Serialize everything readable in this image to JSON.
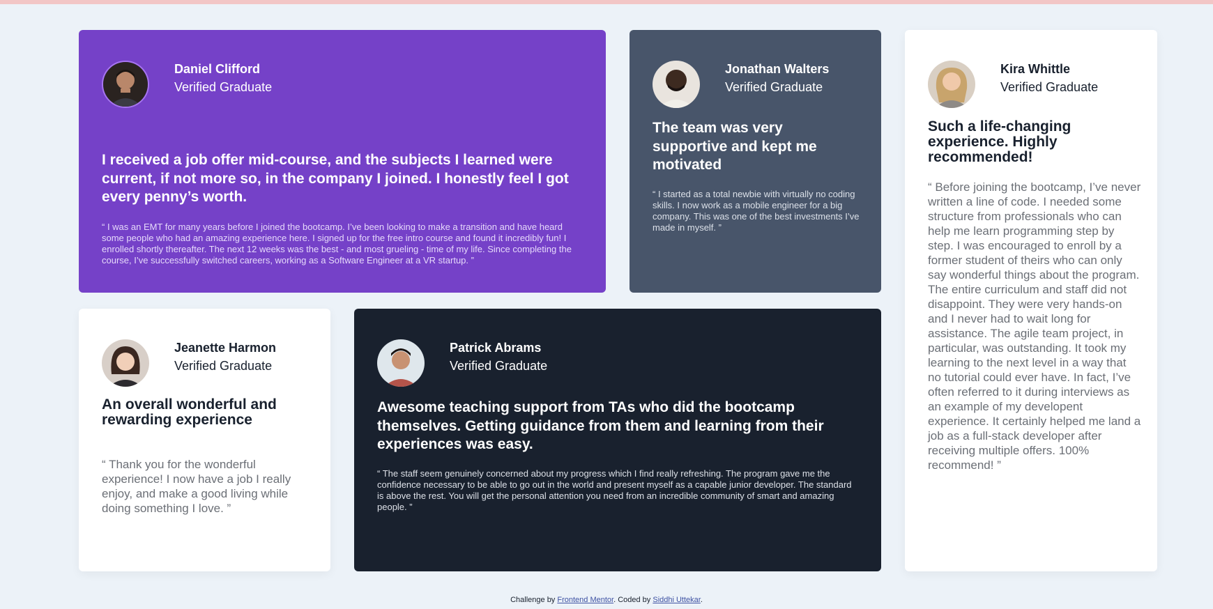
{
  "colors": {
    "page_background": "#ecf2f8",
    "top_bar": "#f2c6c6",
    "purple": "#7541c8",
    "slate": "#48556a",
    "dark": "#19212e",
    "white": "#ffffff",
    "link": "#3e52a3"
  },
  "testimonials": [
    {
      "name": "Daniel Clifford",
      "role": "Verified Graduate",
      "headline": "I received a job offer mid-course, and the subjects I learned were current, if not more so, in the company I joined. I honestly feel I got every penny’s worth.",
      "quote": "“ I was an EMT for many years before I joined the bootcamp. I’ve been looking to make a transition and have heard some people who had an amazing experience here. I signed up for the free intro course and found it incredibly fun! I enrolled shortly thereafter. The next 12 weeks was the best - and most grueling - time of my life. Since completing the course, I’ve successfully switched careers, working as a Software Engineer at a VR startup. ”"
    },
    {
      "name": "Jonathan Walters",
      "role": "Verified Graduate",
      "headline": "The team was very supportive and kept me motivated",
      "quote": "“ I started as a total newbie with virtually no coding skills. I now work as a mobile engineer for a big company. This was one of the best investments I’ve made in myself. ”"
    },
    {
      "name": "Kira Whittle",
      "role": "Verified Graduate",
      "headline": "Such a life-changing experience. Highly recommended!",
      "quote": "“ Before joining the bootcamp, I’ve never written a line of code. I needed some structure from professionals who can help me learn programming step by step. I was encouraged to enroll by a former student of theirs who can only say wonderful things about the program. The entire curriculum and staff did not disappoint. They were very hands-on and I never had to wait long for assistance. The agile team project, in particular, was outstanding. It took my learning to the next level in a way that no tutorial could ever have. In fact, I’ve often referred to it during interviews as an example of my developent experience. It certainly helped me land a job as a full-stack developer after receiving multiple offers. 100% recommend! ”"
    },
    {
      "name": "Jeanette Harmon",
      "role": "Verified Graduate",
      "headline": "An overall wonderful and rewarding experience",
      "quote": "“ Thank you for the wonderful experience! I now have a job I really enjoy, and make a good living while doing something I love. ”"
    },
    {
      "name": "Patrick Abrams",
      "role": "Verified Graduate",
      "headline": "Awesome teaching support from TAs who did the bootcamp themselves. Getting guidance from them and learning from their experiences was easy.",
      "quote": "“ The staff seem genuinely concerned about my progress which I find really refreshing. The program gave me the confidence necessary to be able to go out in the world and present myself as a capable junior developer. The standard is above the rest. You will get the personal attention you need from an incredible community of smart and amazing people. ”"
    }
  ],
  "footer": {
    "challenge_prefix": "Challenge by ",
    "challenge_link": "Frontend Mentor",
    "coded_prefix": ". Coded by ",
    "coded_link": "Siddhi Uttekar",
    "suffix": "."
  }
}
